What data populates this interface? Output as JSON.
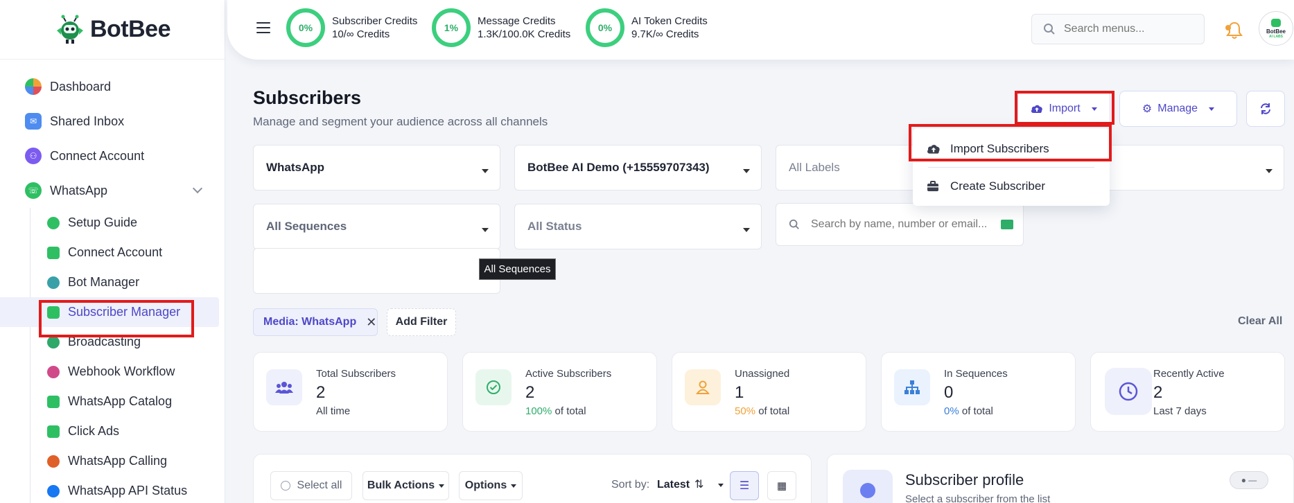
{
  "brand": {
    "name": "BotBee",
    "avatar_line1": "BotBee",
    "avatar_line2": "AI LABS"
  },
  "sidebar": {
    "items": [
      {
        "label": "Dashboard",
        "color": "#f0a23a"
      },
      {
        "label": "Shared Inbox",
        "color": "#4e8cf0"
      },
      {
        "label": "Connect Account",
        "color": "#7c5cf0"
      },
      {
        "label": "WhatsApp",
        "color": "#2fbf63"
      }
    ],
    "whatsapp_sub": [
      {
        "label": "Setup Guide",
        "color": "#2fbf63"
      },
      {
        "label": "Connect Account",
        "color": "#2fbf63"
      },
      {
        "label": "Bot Manager",
        "color": "#3aa0a8"
      },
      {
        "label": "Subscriber Manager",
        "color": "#2fbf63"
      },
      {
        "label": "Broadcasting",
        "color": "#2fa86a"
      },
      {
        "label": "Webhook Workflow",
        "color": "#d04a8a"
      },
      {
        "label": "WhatsApp Catalog",
        "color": "#2fbf63"
      },
      {
        "label": "Click Ads",
        "color": "#2fbf63"
      },
      {
        "label": "WhatsApp Calling",
        "color": "#e0602a"
      },
      {
        "label": "WhatsApp API Status",
        "color": "#1877f2"
      }
    ]
  },
  "header": {
    "credits": [
      {
        "percent": "0%",
        "title": "Subscriber Credits",
        "detail": "10/∞ Credits"
      },
      {
        "percent": "1%",
        "title": "Message Credits",
        "detail": "1.3K/100.0K Credits"
      },
      {
        "percent": "0%",
        "title": "AI Token Credits",
        "detail": "9.7K/∞ Credits"
      }
    ],
    "search_placeholder": "Search menus...",
    "notification_badge": "0"
  },
  "main": {
    "title": "Subscribers",
    "subtitle": "Manage and segment your audience across all channels",
    "import_label": "Import",
    "manage_label": "Manage",
    "dropdown": {
      "import_subscribers": "Import Subscribers",
      "create_subscriber": "Create Subscriber"
    },
    "filters": {
      "channel": "WhatsApp",
      "account": "BotBee AI Demo (+15559707343)",
      "labels": "All Labels",
      "sequences": "All Sequences",
      "status": "All Status",
      "search_placeholder": "Search by name, number or email...",
      "tooltip": "All Sequences"
    },
    "active_filter": "Media: WhatsApp",
    "add_filter": "Add Filter",
    "clear_all": "Clear All",
    "stats": [
      {
        "label": "Total Subscribers",
        "value": "2",
        "foot_highlight": "",
        "foot": "All time",
        "bg": "#eef0fb",
        "fg": "#5b55d6"
      },
      {
        "label": "Active Subscribers",
        "value": "2",
        "foot_highlight": "100%",
        "foot": " of total",
        "bg": "#e8f7ee",
        "fg": "#2fae6a",
        "hl_color": "#2fae6a"
      },
      {
        "label": "Unassigned",
        "value": "1",
        "foot_highlight": "50%",
        "foot": " of total",
        "bg": "#fdf1dc",
        "fg": "#f0a23a",
        "hl_color": "#f0a23a"
      },
      {
        "label": "In Sequences",
        "value": "0",
        "foot_highlight": "0%",
        "foot": " of total",
        "bg": "#e9f2fd",
        "fg": "#3a7fd8",
        "hl_color": "#3a7fd8"
      },
      {
        "label": "Recently Active",
        "value": "2",
        "foot_highlight": "",
        "foot": "Last 7 days",
        "bg": "#eef0fb",
        "fg": "#5b55d6"
      }
    ],
    "toolbar": {
      "select_all": "Select all",
      "bulk_actions": "Bulk Actions",
      "options": "Options",
      "sort_by": "Sort by:",
      "sort_value": "Latest"
    },
    "profile": {
      "title": "Subscriber profile",
      "hint": "Select a subscriber from the list"
    }
  }
}
